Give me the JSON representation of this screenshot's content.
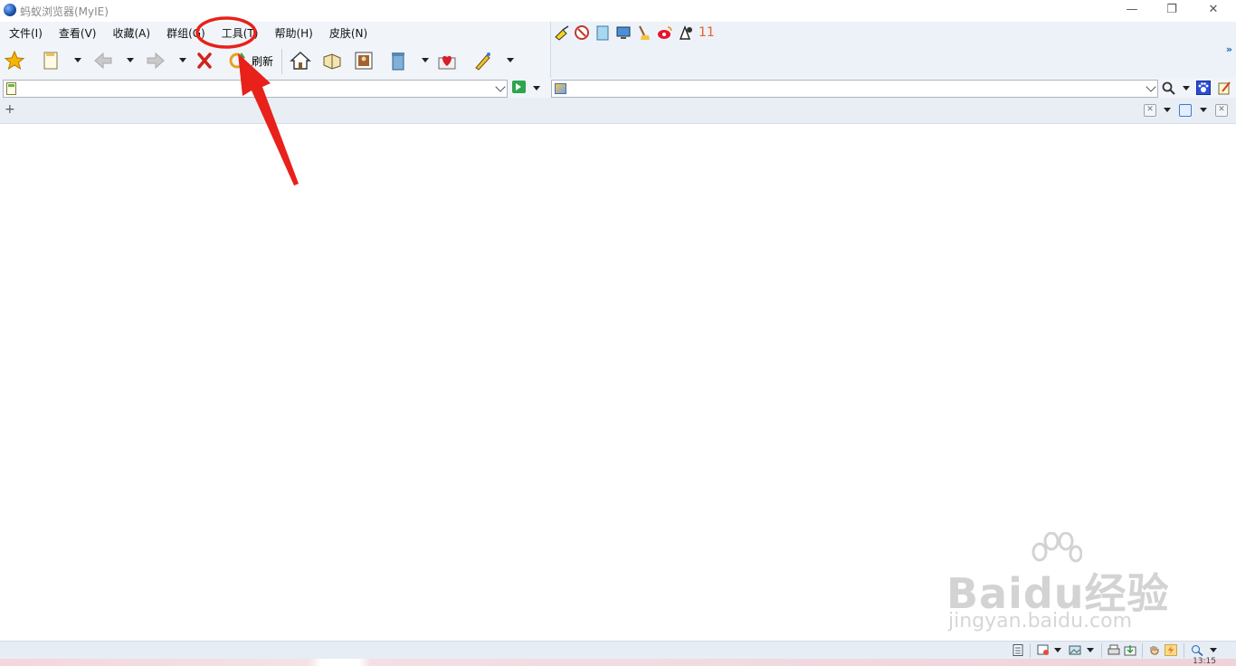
{
  "window": {
    "title": "蚂蚁浏览器(MyIE)",
    "minimize_glyph": "—",
    "restore_glyph": "❐",
    "close_glyph": "✕"
  },
  "menu": [
    {
      "label": "文件(I)"
    },
    {
      "label": "查看(V)"
    },
    {
      "label": "收藏(A)"
    },
    {
      "label": "群组(G)"
    },
    {
      "label": "工具(T)"
    },
    {
      "label": "帮助(H)"
    },
    {
      "label": "皮肤(N)"
    }
  ],
  "toolbar": {
    "refresh_label": "刷新",
    "icons": [
      "favorites-star-icon",
      "new-page-icon",
      "back-arrow-icon",
      "forward-arrow-icon",
      "stop-icon",
      "refresh-icon",
      "home-icon",
      "history-icon",
      "picture-icon",
      "trash-icon",
      "collect-heart-icon",
      "pen-icon"
    ]
  },
  "quick_bar": {
    "icons": [
      "broom-icon",
      "close-popups-icon",
      "clear-cache-icon",
      "screen-icon",
      "cleanup-icon",
      "weibo-icon",
      "sign-icon"
    ],
    "count": "11",
    "more": "»"
  },
  "address": {
    "value": "",
    "placeholder": ""
  },
  "search": {
    "value": "",
    "placeholder": ""
  },
  "tabs": {
    "new_tab_symbol": "+"
  },
  "colors": {
    "annotation_red": "#e8211a",
    "chrome_bg": "#f1f5fa",
    "count_orange": "#e8602c"
  },
  "statusbar": {
    "icons": [
      "page-icon",
      "popup-icon",
      "image-icon",
      "print-icon",
      "download-icon",
      "hand-icon",
      "flash-icon",
      "zoom-icon"
    ],
    "time_partial": "13:15"
  },
  "watermark": {
    "brand": "Baidu经验",
    "url": "jingyan.baidu.com"
  }
}
